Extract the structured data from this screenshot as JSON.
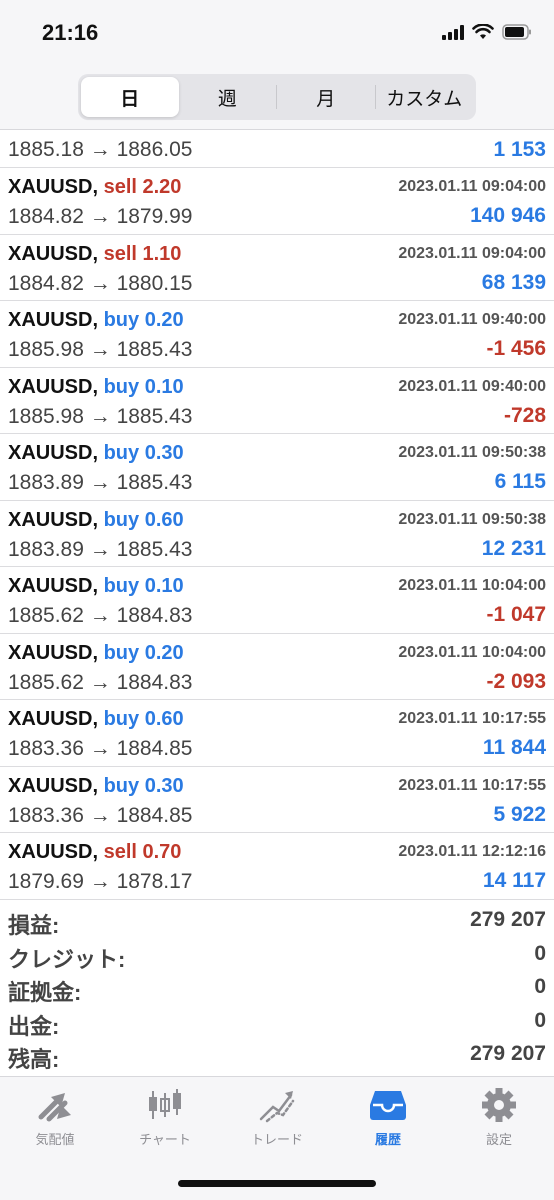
{
  "status_bar": {
    "time": "21:16",
    "icons": [
      "cellular-signal-icon",
      "wifi-icon",
      "battery-icon"
    ]
  },
  "period_tabs": [
    {
      "label": "日",
      "active": true
    },
    {
      "label": "週",
      "active": false
    },
    {
      "label": "月",
      "active": false
    },
    {
      "label": "カスタム",
      "active": false
    }
  ],
  "partial_row": {
    "prices": "1885.18 → 1886.05",
    "profit": "1 153"
  },
  "trades": [
    {
      "symbol": "XAUUSD,",
      "side": "sell 2.20",
      "type": "sell",
      "time": "2023.01.11 09:04:00",
      "prices": "1884.82 → 1879.99",
      "profit": "140 946",
      "sign": "pos"
    },
    {
      "symbol": "XAUUSD,",
      "side": "sell 1.10",
      "type": "sell",
      "time": "2023.01.11 09:04:00",
      "prices": "1884.82 → 1880.15",
      "profit": "68 139",
      "sign": "pos"
    },
    {
      "symbol": "XAUUSD,",
      "side": "buy 0.20",
      "type": "buy",
      "time": "2023.01.11 09:40:00",
      "prices": "1885.98 → 1885.43",
      "profit": "-1 456",
      "sign": "neg"
    },
    {
      "symbol": "XAUUSD,",
      "side": "buy 0.10",
      "type": "buy",
      "time": "2023.01.11 09:40:00",
      "prices": "1885.98 → 1885.43",
      "profit": "-728",
      "sign": "neg"
    },
    {
      "symbol": "XAUUSD,",
      "side": "buy 0.30",
      "type": "buy",
      "time": "2023.01.11 09:50:38",
      "prices": "1883.89 → 1885.43",
      "profit": "6 115",
      "sign": "pos"
    },
    {
      "symbol": "XAUUSD,",
      "side": "buy 0.60",
      "type": "buy",
      "time": "2023.01.11 09:50:38",
      "prices": "1883.89 → 1885.43",
      "profit": "12 231",
      "sign": "pos"
    },
    {
      "symbol": "XAUUSD,",
      "side": "buy 0.10",
      "type": "buy",
      "time": "2023.01.11 10:04:00",
      "prices": "1885.62 → 1884.83",
      "profit": "-1 047",
      "sign": "neg"
    },
    {
      "symbol": "XAUUSD,",
      "side": "buy 0.20",
      "type": "buy",
      "time": "2023.01.11 10:04:00",
      "prices": "1885.62 → 1884.83",
      "profit": "-2 093",
      "sign": "neg"
    },
    {
      "symbol": "XAUUSD,",
      "side": "buy 0.60",
      "type": "buy",
      "time": "2023.01.11 10:17:55",
      "prices": "1883.36 → 1884.85",
      "profit": "11 844",
      "sign": "pos"
    },
    {
      "symbol": "XAUUSD,",
      "side": "buy 0.30",
      "type": "buy",
      "time": "2023.01.11 10:17:55",
      "prices": "1883.36 → 1884.85",
      "profit": "5 922",
      "sign": "pos"
    },
    {
      "symbol": "XAUUSD,",
      "side": "sell 0.70",
      "type": "sell",
      "time": "2023.01.11 12:12:16",
      "prices": "1879.69 → 1878.17",
      "profit": "14 117",
      "sign": "pos"
    }
  ],
  "summary": [
    {
      "label": "損益:",
      "value": "279 207"
    },
    {
      "label": "クレジット:",
      "value": "0"
    },
    {
      "label": "証拠金:",
      "value": "0"
    },
    {
      "label": "出金:",
      "value": "0"
    },
    {
      "label": "残高:",
      "value": "279 207"
    }
  ],
  "tab_bar": [
    {
      "label": "気配値",
      "icon": "quotes-arrows-icon",
      "active": false
    },
    {
      "label": "チャート",
      "icon": "candlestick-chart-icon",
      "active": false
    },
    {
      "label": "トレード",
      "icon": "trade-line-icon",
      "active": false
    },
    {
      "label": "履歴",
      "icon": "history-inbox-icon",
      "active": true
    },
    {
      "label": "設定",
      "icon": "gear-icon",
      "active": false
    }
  ],
  "colors": {
    "buy": "#2a7ae2",
    "sell": "#c0392b",
    "active_tab": "#2a7ae2",
    "inactive_tab": "#8e8e93"
  }
}
